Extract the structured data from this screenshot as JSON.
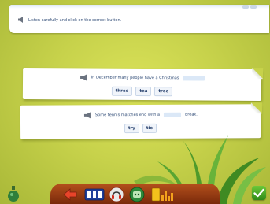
{
  "instruction": "Listen carefully and click on the correct button.",
  "questions": [
    {
      "prefix": "In December many people have a Christmas",
      "suffix": "",
      "options": [
        "three",
        "tea",
        "tree"
      ]
    },
    {
      "prefix": "Some tennis matches end with a",
      "suffix": "break.",
      "options": [
        "try",
        "tie"
      ]
    }
  ],
  "toolbar": {
    "icons": [
      "back-arrow-icon",
      "scoreboard-icon",
      "headphones-icon",
      "robot-helper-icon",
      "bar-chart-icon"
    ]
  },
  "colors": {
    "background": "#c3ce49",
    "text": "#35507a",
    "toolbar": "#9b3f13",
    "check": "#3fa51f"
  }
}
